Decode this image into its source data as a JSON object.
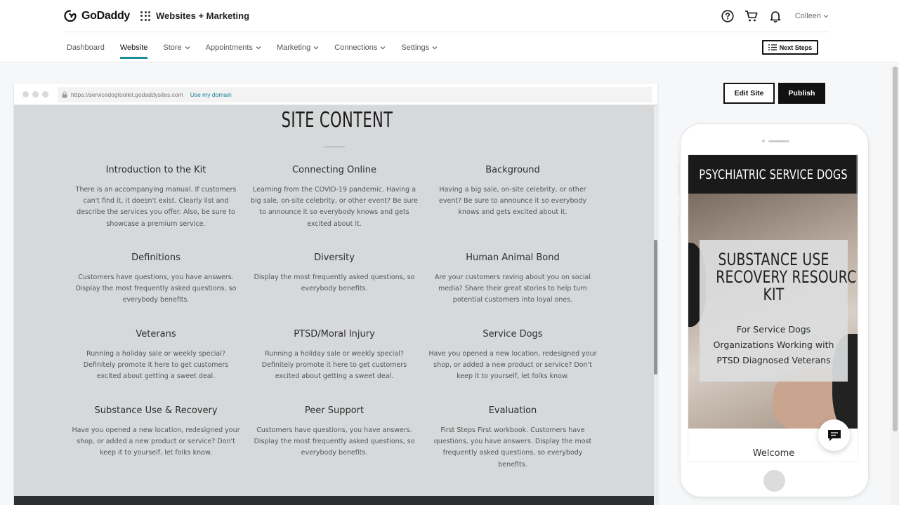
{
  "header": {
    "brand": "GoDaddy",
    "app_name": "Websites + Marketing",
    "user": "Colleen",
    "icons": [
      "help-icon",
      "cart-icon",
      "bell-icon"
    ]
  },
  "nav": {
    "items": [
      {
        "label": "Dashboard",
        "dropdown": false
      },
      {
        "label": "Website",
        "dropdown": false,
        "active": true
      },
      {
        "label": "Store",
        "dropdown": true
      },
      {
        "label": "Appointments",
        "dropdown": true
      },
      {
        "label": "Marketing",
        "dropdown": true
      },
      {
        "label": "Connections",
        "dropdown": true
      },
      {
        "label": "Settings",
        "dropdown": true
      }
    ],
    "next_steps": "Next Steps"
  },
  "browser": {
    "url": "https://servicedogtoolkit.godaddysites.com",
    "domain_link": "Use my domain"
  },
  "content": {
    "title": "SITE CONTENT",
    "sections": [
      {
        "heading": "Introduction to the Kit",
        "body": "There is an accompanying manual. If customers can't find it, it doesn't exist. Clearly list and describe the services you offer. Also, be sure to showcase a premium service."
      },
      {
        "heading": "Connecting Online",
        "body": "Learning from the COVID-19 pandemic. Having a big sale, on-site celebrity, or other event? Be sure to announce it so everybody knows and gets excited about it."
      },
      {
        "heading": "Background",
        "body": "Having a big sale, on-site celebrity, or other event? Be sure to announce it so everybody knows and gets excited about it."
      },
      {
        "heading": "Definitions",
        "body": "Customers have questions, you have answers. Display the most frequently asked questions, so everybody benefits."
      },
      {
        "heading": "Diversity",
        "body": "Display the most frequently asked questions, so everybody benefits."
      },
      {
        "heading": "Human Animal Bond",
        "body": "Are your customers raving about you on social media? Share their great stories to help turn potential customers into loyal ones."
      },
      {
        "heading": "Veterans",
        "body": "Running a holiday sale or weekly special? Definitely promote it here to get customers excited about getting a sweet deal."
      },
      {
        "heading": "PTSD/Moral Injury",
        "body": "Running a holiday sale or weekly special? Definitely promote it here to get customers excited about getting a sweet deal."
      },
      {
        "heading": "Service Dogs",
        "body": "Have you opened a new location, redesigned your shop, or added a new product or service? Don't keep it to yourself, let folks know."
      },
      {
        "heading": "Substance Use & Recovery",
        "body": "Have you opened a new location, redesigned your shop, or added a new product or service? Don't keep it to yourself, let folks know."
      },
      {
        "heading": "Peer Support",
        "body": "Customers have questions, you have answers. Display the most frequently asked questions, so everybody benefits."
      },
      {
        "heading": "Evaluation",
        "body": "First Steps First workbook. Customers have questions, you have answers. Display the most frequently asked questions, so everybody benefits."
      }
    ]
  },
  "actions": {
    "edit_site": "Edit Site",
    "publish": "Publish"
  },
  "phone_preview": {
    "site_header": "PSYCHIATRIC SERVICE DOGS",
    "hero_title_lines": [
      "SUBSTANCE USE",
      "RECOVERY RESOURCE",
      "KIT"
    ],
    "hero_sub_lines": [
      "For Service Dogs",
      "Organizations Working with",
      "PTSD Diagnosed Veterans"
    ],
    "welcome": "Welcome"
  },
  "colors": {
    "accent": "#1a8e94",
    "content_bg": "#d6d8da",
    "dark": "#111111"
  }
}
